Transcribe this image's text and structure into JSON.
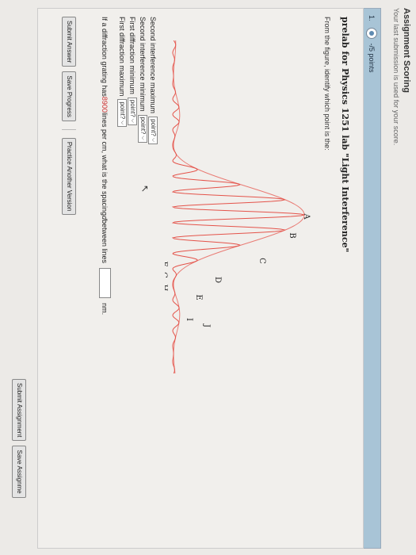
{
  "section": {
    "title": "Assignment Scoring",
    "subtitle": "Your last submission is used for your score."
  },
  "question": {
    "number": "1.",
    "points": "-/5 points",
    "title": "prelab for Physics 1251 lab \"Light Interference\"",
    "prompt": "From the figure, identify which point is the:",
    "figure_labels": [
      "A",
      "B",
      "C",
      "D",
      "E",
      "F",
      "G",
      "H",
      "I",
      "J"
    ],
    "answers": [
      {
        "label": "Second interference maximum",
        "value": "point?"
      },
      {
        "label": "Second interference minimum",
        "value": "point?"
      },
      {
        "label": "First diffraction minimum",
        "value": "point?"
      },
      {
        "label": "First diffraction maximum",
        "value": "point?"
      }
    ],
    "spacing": {
      "before": "If a diffraction grating has ",
      "lines": "8900",
      "after": " lines per cm, what is the spacing ",
      "d": "d",
      "after2": " between lines",
      "unit": "nm."
    }
  },
  "buttons": {
    "submit_answer": "Submit Answer",
    "save_progress": "Save Progress",
    "practice": "Practice Another Version",
    "submit_assignment": "Submit Assignment",
    "save_assignment": "Save Assignme"
  },
  "colors": {
    "pattern": "#e4534a",
    "envelope": "#e97b74",
    "accent": "#5f8bb1",
    "question_bar": "#a8c4d6"
  }
}
